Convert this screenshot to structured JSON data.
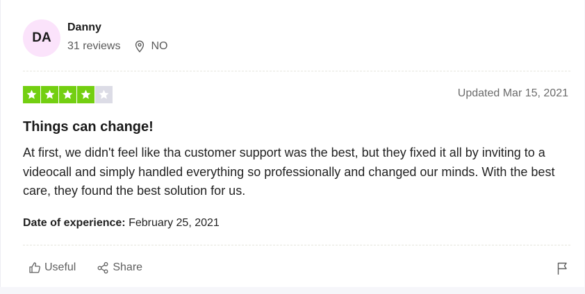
{
  "reviewer": {
    "initials": "DA",
    "name": "Danny",
    "reviews": "31 reviews",
    "location": "NO"
  },
  "rating": {
    "stars": 4,
    "max": 5,
    "filled_color": "#73cf11",
    "empty_color": "#dcdce6"
  },
  "review": {
    "updated": "Updated Mar 15, 2021",
    "title": "Things can change!",
    "body": "At first, we didn't feel like tha customer support was the best, but they fixed it all by inviting to a videocall and simply handled everything so professionally and changed our minds. With the best care, they found the best solution for us.",
    "experience_label": "Date of experience:",
    "experience_date": "February 25, 2021"
  },
  "actions": {
    "useful_label": "Useful",
    "share_label": "Share"
  },
  "icons": {
    "location": "location-pin-icon",
    "useful": "thumbs-up-icon",
    "share": "share-icon",
    "report": "flag-icon"
  }
}
